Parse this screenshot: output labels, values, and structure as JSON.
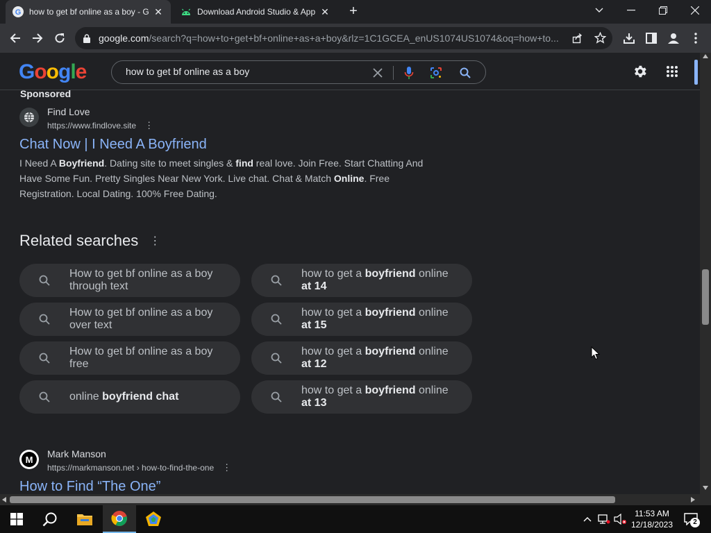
{
  "browser": {
    "tabs": [
      {
        "title": "how to get bf online as a boy - G",
        "active": true
      },
      {
        "title": "Download Android Studio & App",
        "active": false
      }
    ],
    "url_domain": "google.com",
    "url_rest": "/search?q=how+to+get+bf+online+as+a+boy&rlz=1C1GCEA_enUS1074US1074&oq=how+to..."
  },
  "google": {
    "logo": "Google",
    "search_query": "how to get bf online as a boy"
  },
  "ad": {
    "sponsored_label": "Sponsored",
    "site_name": "Find Love",
    "site_url": "https://www.findlove.site",
    "title": "Chat Now | I Need A Boyfriend",
    "desc": [
      {
        "t": "I Need A ",
        "b": false
      },
      {
        "t": "Boyfriend",
        "b": true
      },
      {
        "t": ". Dating site to meet singles & ",
        "b": false
      },
      {
        "t": "find",
        "b": true
      },
      {
        "t": " real love. Join Free. Start Chatting And Have Some Fun. Pretty Singles Near New York. Live chat. Chat & Match ",
        "b": false
      },
      {
        "t": "Online",
        "b": true
      },
      {
        "t": ". Free Registration. Local Dating. 100% Free Dating.",
        "b": false
      }
    ]
  },
  "related": {
    "heading": "Related searches",
    "items": [
      {
        "line1": [
          {
            "t": "How to get bf online as a boy",
            "b": false
          }
        ],
        "line2": [
          {
            "t": "through text",
            "b": false
          }
        ]
      },
      {
        "line1": [
          {
            "t": "how to get a ",
            "b": false
          },
          {
            "t": "boyfriend",
            "b": true
          },
          {
            "t": " online",
            "b": false
          }
        ],
        "line2": [
          {
            "t": "at 14",
            "b": true
          }
        ]
      },
      {
        "line1": [
          {
            "t": "How to get bf online as a boy",
            "b": false
          }
        ],
        "line2": [
          {
            "t": "over text",
            "b": false
          }
        ]
      },
      {
        "line1": [
          {
            "t": "how to get a ",
            "b": false
          },
          {
            "t": "boyfriend",
            "b": true
          },
          {
            "t": " online",
            "b": false
          }
        ],
        "line2": [
          {
            "t": "at 15",
            "b": true
          }
        ]
      },
      {
        "line1": [
          {
            "t": "How to get bf online as a boy",
            "b": false
          }
        ],
        "line2": [
          {
            "t": "free",
            "b": false
          }
        ]
      },
      {
        "line1": [
          {
            "t": "how to get a ",
            "b": false
          },
          {
            "t": "boyfriend",
            "b": true
          },
          {
            "t": " online",
            "b": false
          }
        ],
        "line2": [
          {
            "t": "at 12",
            "b": true
          }
        ]
      },
      {
        "line1": [
          {
            "t": "online ",
            "b": false
          },
          {
            "t": "boyfriend chat",
            "b": true
          }
        ],
        "line2": []
      },
      {
        "line1": [
          {
            "t": "how to get a ",
            "b": false
          },
          {
            "t": "boyfriend",
            "b": true
          },
          {
            "t": " online",
            "b": false
          }
        ],
        "line2": [
          {
            "t": "at 13",
            "b": true
          }
        ]
      }
    ]
  },
  "result2": {
    "logo_letter": "M",
    "site_name": "Mark Manson",
    "site_url": "https://markmanson.net › how-to-find-the-one",
    "title": "How to Find “The One”"
  },
  "taskbar": {
    "time": "11:53 AM",
    "date": "12/18/2023",
    "notification_count": "2"
  },
  "colors": {
    "link": "#8ab4f8",
    "background": "#202124",
    "chip": "#303134"
  }
}
